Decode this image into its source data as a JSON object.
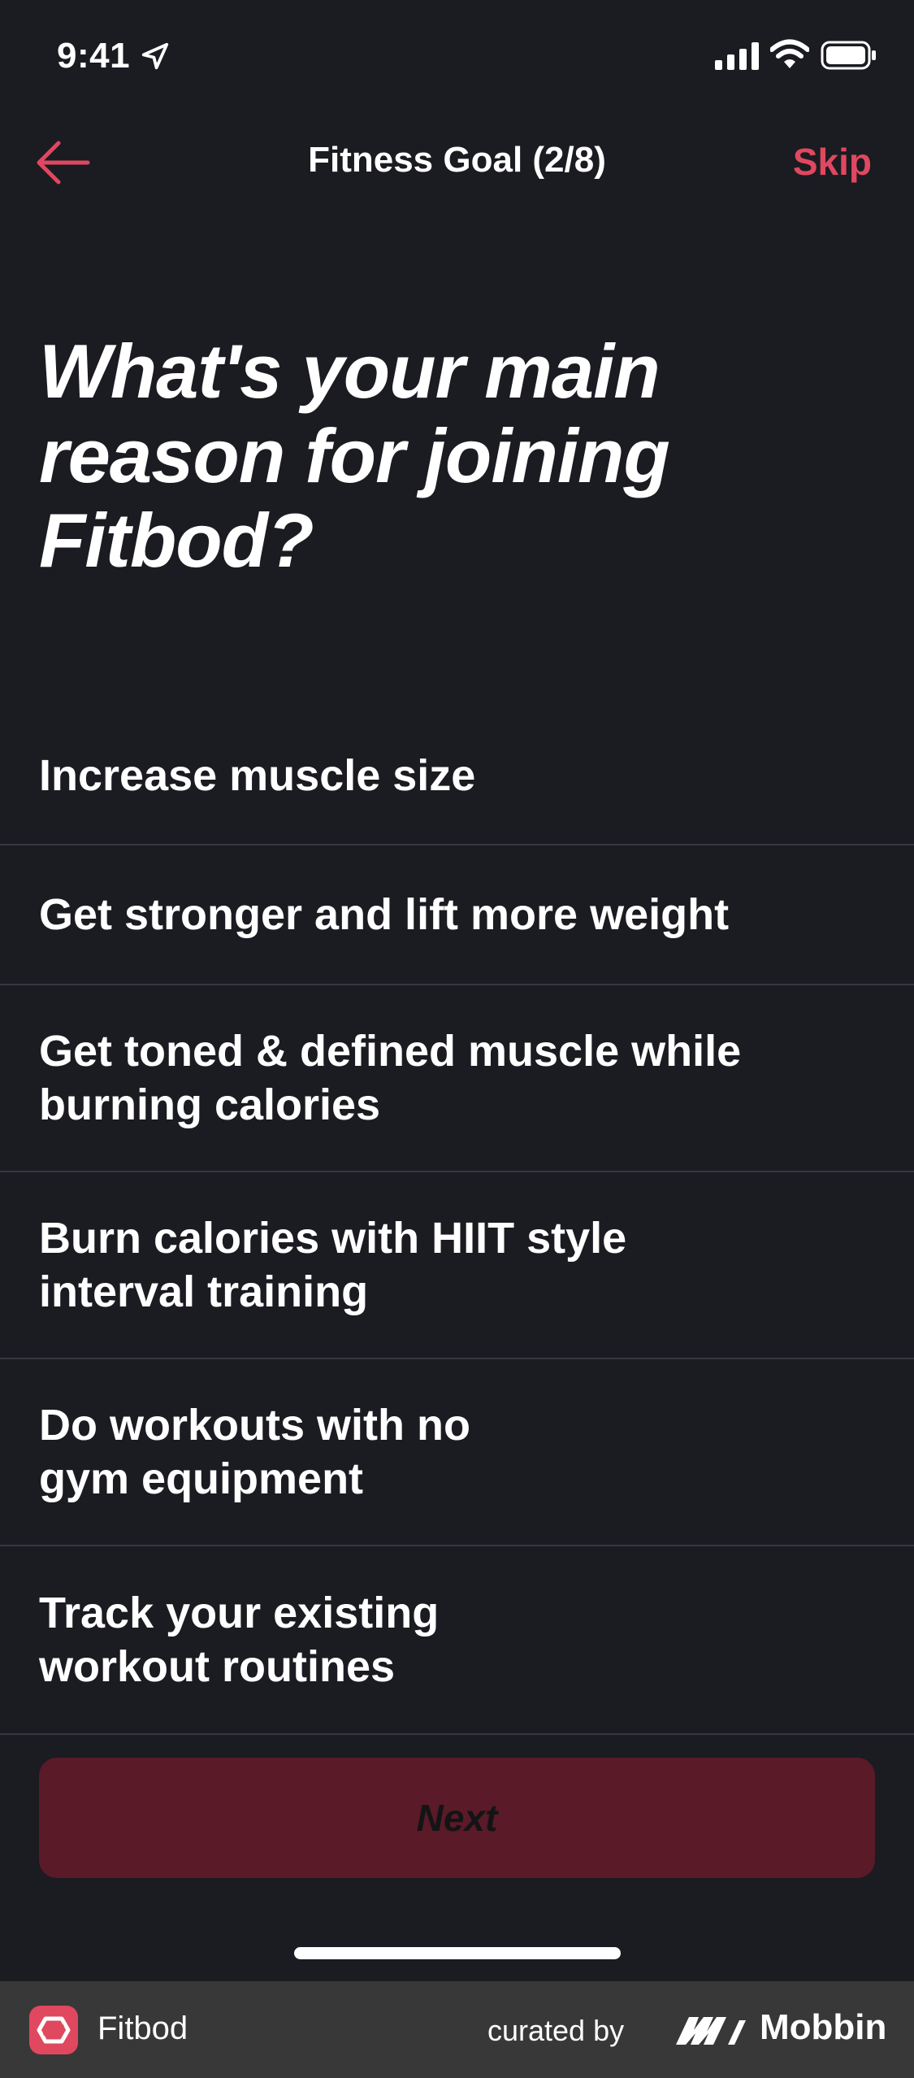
{
  "status_bar": {
    "time": "9:41"
  },
  "header": {
    "title": "Fitness Goal (2/8)",
    "skip_label": "Skip"
  },
  "question": "What's your main reason for joining Fitbod?",
  "options": [
    {
      "label": "Increase muscle size"
    },
    {
      "label": "Get stronger and lift more weight"
    },
    {
      "label": "Get toned & defined muscle while burning calories"
    },
    {
      "label": "Burn calories with HIIT style interval training"
    },
    {
      "label": "Do workouts with no gym equipment"
    },
    {
      "label": "Track your existing workout routines"
    }
  ],
  "next_label": "Next",
  "footer": {
    "app_name": "Fitbod",
    "curated_by": "curated by",
    "brand": "Mobbin"
  },
  "colors": {
    "background": "#1b1b22",
    "accent": "#e0485f",
    "next_button_disabled": "#5a1a27",
    "divider": "#373742"
  }
}
